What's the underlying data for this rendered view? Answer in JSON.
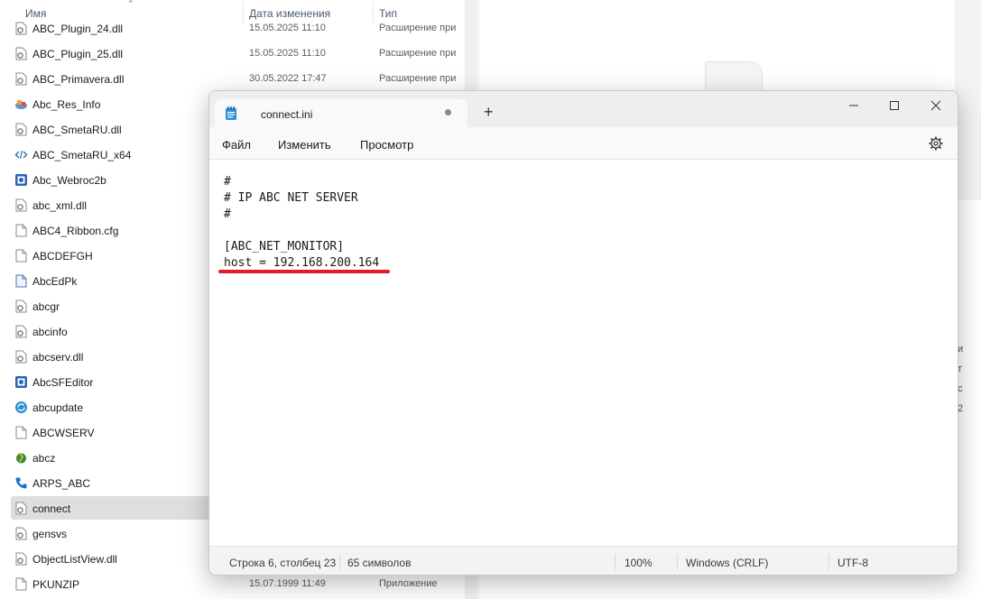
{
  "explorer": {
    "columns": {
      "name": "Имя",
      "date": "Дата изменения",
      "type": "Тип"
    },
    "files": [
      {
        "name": "ABC_Plugin_24.dll",
        "date": "15.05.2025 11:10",
        "type": "Расширение при",
        "icon": "dll-gear-icon"
      },
      {
        "name": "ABC_Plugin_25.dll",
        "date": "15.05.2025 11:10",
        "type": "Расширение при",
        "icon": "dll-gear-icon"
      },
      {
        "name": "ABC_Primavera.dll",
        "date": "30.05.2022 17:47",
        "type": "Расширение при",
        "icon": "dll-gear-icon"
      },
      {
        "name": "Abc_Res_Info",
        "date": "",
        "type": "",
        "icon": "app-colorful-icon"
      },
      {
        "name": "ABC_SmetaRU.dll",
        "date": "",
        "type": "",
        "icon": "dll-gear-icon"
      },
      {
        "name": "ABC_SmetaRU_x64",
        "date": "",
        "type": "",
        "icon": "code-icon"
      },
      {
        "name": "Abc_Webroc2b",
        "date": "",
        "type": "",
        "icon": "app-blue-icon"
      },
      {
        "name": "abc_xml.dll",
        "date": "",
        "type": "",
        "icon": "dll-gear-icon"
      },
      {
        "name": "ABC4_Ribbon.cfg",
        "date": "",
        "type": "",
        "icon": "file-icon"
      },
      {
        "name": "ABCDEFGH",
        "date": "",
        "type": "",
        "icon": "file-icon"
      },
      {
        "name": "AbcEdPk",
        "date": "",
        "type": "",
        "icon": "document-blue-icon"
      },
      {
        "name": "abcgr",
        "date": "",
        "type": "",
        "icon": "dll-gear-icon"
      },
      {
        "name": "abcinfo",
        "date": "",
        "type": "",
        "icon": "dll-gear-icon"
      },
      {
        "name": "abcserv.dll",
        "date": "",
        "type": "",
        "icon": "dll-gear-icon"
      },
      {
        "name": "AbcSFEditor",
        "date": "",
        "type": "",
        "icon": "app-blue-icon"
      },
      {
        "name": "abcupdate",
        "date": "",
        "type": "",
        "icon": "update-icon"
      },
      {
        "name": "ABCWSERV",
        "date": "",
        "type": "",
        "icon": "file-icon"
      },
      {
        "name": "abcz",
        "date": "",
        "type": "",
        "icon": "app-green-icon"
      },
      {
        "name": "ARPS_ABC",
        "date": "",
        "type": "",
        "icon": "phone-icon"
      },
      {
        "name": "connect",
        "date": "",
        "type": "",
        "icon": "ini-gear-icon",
        "selected": true
      },
      {
        "name": "gensvs",
        "date": "",
        "type": "",
        "icon": "dll-gear-icon"
      },
      {
        "name": "ObjectListView.dll",
        "date": "",
        "type": "",
        "icon": "dll-gear-icon"
      },
      {
        "name": "PKUNZIP",
        "date": "15.07.1999 11:49",
        "type": "Приложение",
        "icon": "file-icon"
      }
    ],
    "side_chars": [
      "и",
      "т",
      "с",
      "2"
    ]
  },
  "notepad": {
    "tab_title": "connect.ini",
    "new_tab_label": "+",
    "menu": {
      "file": "Файл",
      "edit": "Изменить",
      "view": "Просмотр"
    },
    "lines": [
      "#",
      "# IP ABC NET SERVER",
      "#",
      "",
      "[ABC_NET_MONITOR]",
      "host = 192.168.200.164"
    ],
    "status": {
      "position": "Строка 6, столбец 23",
      "chars": "65 символов",
      "zoom": "100%",
      "line_ending": "Windows (CRLF)",
      "encoding": "UTF-8"
    },
    "colors": {
      "highlight": "#e01b2a",
      "selection": "#dedede"
    }
  }
}
